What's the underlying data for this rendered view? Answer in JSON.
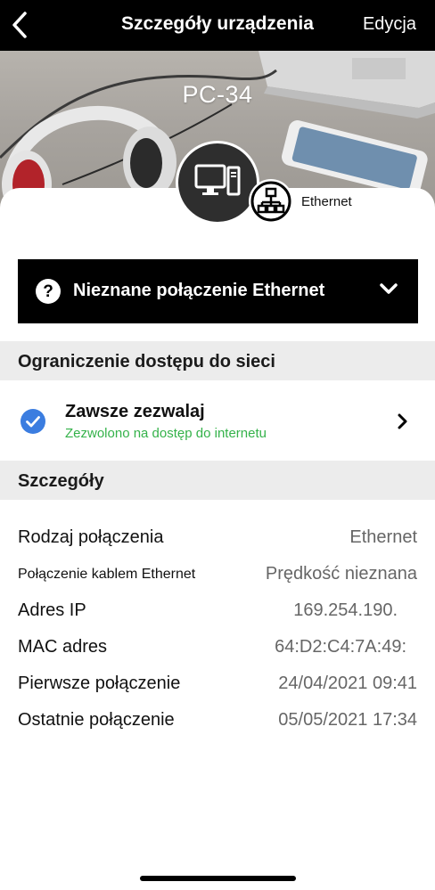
{
  "nav": {
    "title": "Szczegóły urządzenia",
    "edit_label": "Edycja"
  },
  "device": {
    "name": "PC-34",
    "connection_type_label": "Ethernet"
  },
  "connection_banner": {
    "text": "Nieznane połączenie Ethernet"
  },
  "access_section": {
    "header": "Ograniczenie dostępu do sieci",
    "item_title": "Zawsze zezwalaj",
    "item_subtitle": "Zezwolono na dostęp do internetu"
  },
  "details_section": {
    "header": "Szczegóły",
    "rows": [
      {
        "label": "Rodzaj połączenia",
        "value": "Ethernet"
      },
      {
        "label": "Połączenie kablem Ethernet",
        "value": "Prędkość nieznana"
      },
      {
        "label": "Adres IP",
        "value": "169.254.190."
      },
      {
        "label": "MAC adres",
        "value": "64:D2:C4:7A:49:"
      },
      {
        "label": "Pierwsze połączenie",
        "value": "24/04/2021 09:41"
      },
      {
        "label": "Ostatnie połączenie",
        "value": "05/05/2021 17:34"
      }
    ]
  },
  "colors": {
    "accent_blue": "#3b7de0",
    "success_green": "#34b24a",
    "section_bg": "#ececec"
  }
}
